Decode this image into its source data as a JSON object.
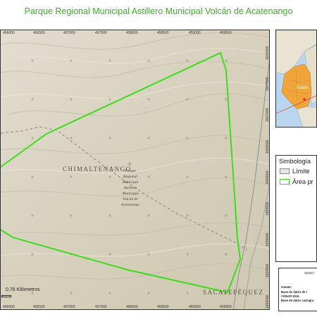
{
  "title": "Parque Regional Municipal Astillero Municipal Volcán de Acatenango",
  "map": {
    "x_ticks": [
      "456000",
      "456500",
      "457000",
      "457500",
      "458000",
      "458500",
      "459000",
      "459500"
    ],
    "x_ticks_bottom": [
      "456000",
      "456500",
      "457000",
      "457500",
      "458000",
      "458500",
      "459000",
      "459500"
    ],
    "y_ticks": [
      "1608000",
      "1607500",
      "1607000",
      "1606500",
      "1606000",
      "1605500",
      "1605000",
      "1604500",
      "1604000"
    ],
    "places": {
      "north": "CHIMALTENANGO",
      "south": "SACATEPÉQUEZ"
    },
    "area_label": [
      "Parque",
      "Regional",
      "Municipal",
      "Astillero",
      "Municipal",
      "Volcán de",
      "Acatenango"
    ],
    "scale_text": "0.76 Kilómetros",
    "colors": {
      "protected_area": "#3fdc1e",
      "terrain": "#d9d3c2",
      "boundary": "#8a8a8a"
    }
  },
  "inset": {
    "region_label": "Guate"
  },
  "legend": {
    "title": "Simbología",
    "items": [
      {
        "label": "Límite",
        "color": "#e6e6e6",
        "border": "#888888"
      },
      {
        "label": "Área pr",
        "color": "#ffffff",
        "border": "#3fdc1e"
      }
    ]
  },
  "info": {
    "system": "Sistem",
    "source_label": "Fuente:",
    "lines": [
      "Base de datos de l",
      "CONAP 2016",
      "Base de datos cartogra"
    ]
  }
}
